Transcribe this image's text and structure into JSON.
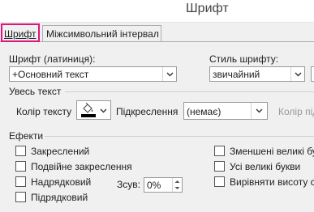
{
  "window": {
    "title": "Шрифт"
  },
  "tabs": [
    {
      "label": "Шрифт",
      "active": true
    },
    {
      "label": "Міжсимвольний інтервал",
      "active": false
    }
  ],
  "font_latin": {
    "label": "Шрифт (латиниця):",
    "value": "+Основний текст"
  },
  "font_style": {
    "label": "Стиль шрифту:",
    "value": "звичайний"
  },
  "all_text": {
    "header": "Увесь текст",
    "font_color_label": "Колір тексту",
    "font_color": "#000000",
    "underline_label": "Підкреслення",
    "underline_value": "(немає)",
    "underline_color_label": "Колір підк"
  },
  "effects": {
    "header": "Ефекти",
    "left": [
      {
        "label": "Закреслений",
        "checked": false
      },
      {
        "label": "Подвійне закреслення",
        "checked": false
      },
      {
        "label": "Надрядковий",
        "checked": false
      },
      {
        "label": "Підрядковий",
        "checked": false
      }
    ],
    "offset_label": "Зсув:",
    "offset_value": "0%",
    "right": [
      {
        "label": "Зменшені великі бу",
        "checked": false
      },
      {
        "label": "Усі великі букви",
        "checked": false
      },
      {
        "label": "Вирівняти висоту с",
        "checked": false
      }
    ]
  },
  "colors": {
    "accent_highlight": "#e0147a",
    "dialog_bg": "#f0f0f0"
  }
}
